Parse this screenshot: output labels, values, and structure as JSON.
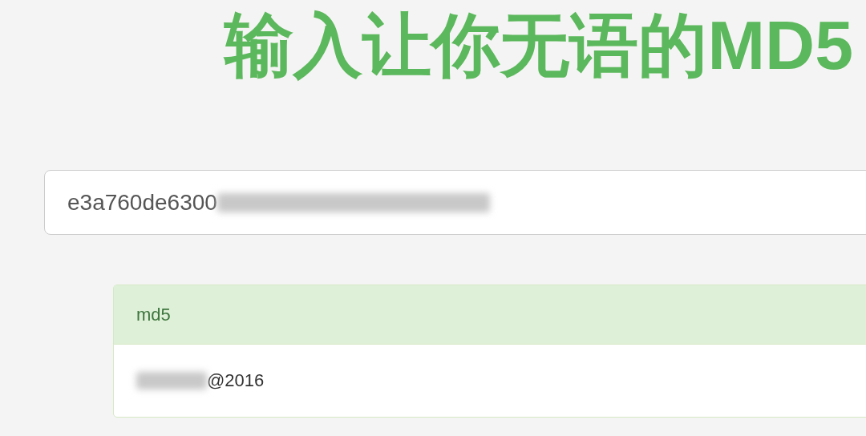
{
  "title": "输入让你无语的MD5",
  "search": {
    "value": "e3a760de6300",
    "redacted": true
  },
  "result": {
    "header": "md5",
    "value": "@2016",
    "redacted": true
  }
}
